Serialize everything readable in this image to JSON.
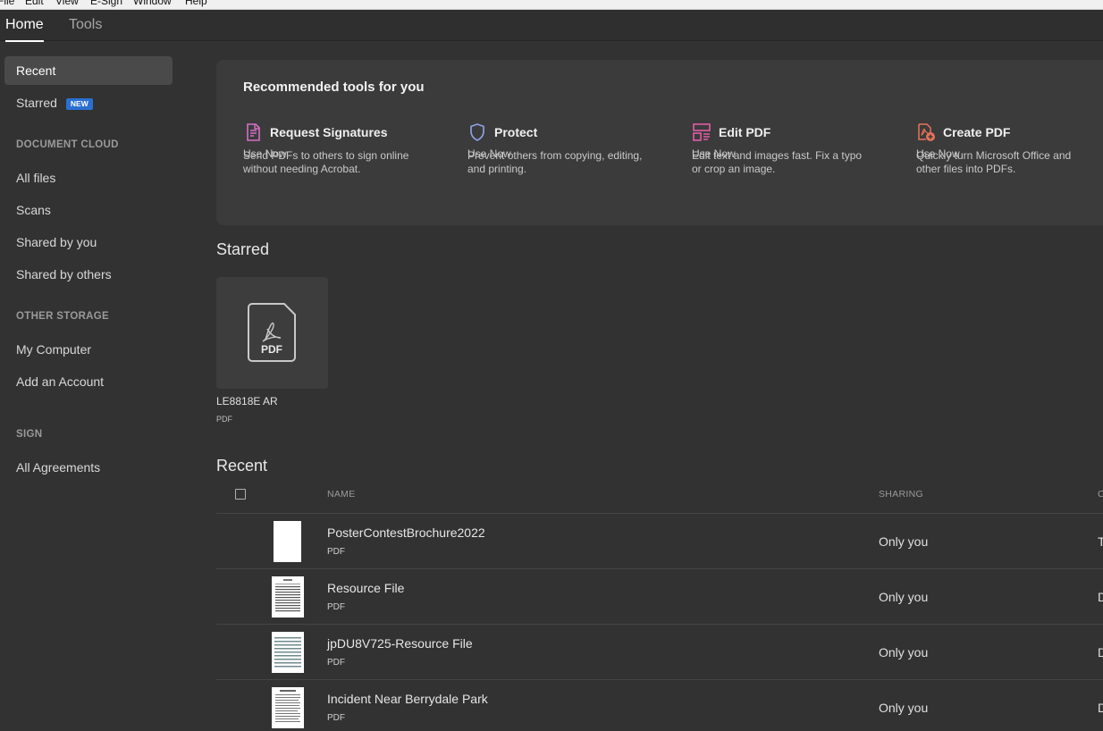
{
  "menubar": {
    "items": [
      "File",
      "Edit",
      "View",
      "E-Sign",
      "Window",
      "Help"
    ]
  },
  "tabs": [
    {
      "label": "Home",
      "active": true
    },
    {
      "label": "Tools",
      "active": false
    }
  ],
  "sidebar": {
    "recent": "Recent",
    "starred": "Starred",
    "new_badge": "NEW",
    "document_cloud_heading": "DOCUMENT CLOUD",
    "all_files": "All files",
    "scans": "Scans",
    "shared_by_you": "Shared by you",
    "shared_by_others": "Shared by others",
    "other_storage_heading": "OTHER STORAGE",
    "my_computer": "My Computer",
    "add_account": "Add an Account",
    "sign_heading": "SIGN",
    "all_agreements": "All Agreements"
  },
  "recommended": {
    "title": "Recommended tools for you",
    "tools": [
      {
        "name": "Request Signatures",
        "desc": "Send PDFs to others to sign online without needing Acrobat.",
        "action": "Use Now",
        "icon": "request-signatures-icon",
        "color": "#d46fc7"
      },
      {
        "name": "Protect",
        "desc": "Prevent others from copying, editing, and printing.",
        "action": "Use Now",
        "icon": "shield-icon",
        "color": "#8e9fe0"
      },
      {
        "name": "Edit PDF",
        "desc": "Edit text and images fast. Fix a typo or crop an image.",
        "action": "Use Now",
        "icon": "edit-pdf-icon",
        "color": "#e05ea8"
      },
      {
        "name": "Create PDF",
        "desc": "Quickly turn Microsoft Office and other files into PDFs.",
        "action": "Use Now",
        "icon": "create-pdf-icon",
        "color": "#e8735a"
      }
    ]
  },
  "starred": {
    "title": "Starred",
    "file": {
      "name": "LE8818E AR",
      "type": "PDF",
      "thumb_label": "PDF"
    }
  },
  "recent": {
    "title": "Recent",
    "columns": {
      "name": "NAME",
      "sharing": "SHARING",
      "extra": "C"
    },
    "rows": [
      {
        "name": "PosterContestBrochure2022",
        "type": "PDF",
        "sharing": "Only you",
        "extra": "T"
      },
      {
        "name": "Resource File",
        "type": "PDF",
        "sharing": "Only you",
        "extra": "D"
      },
      {
        "name": "jpDU8V725-Resource File",
        "type": "PDF",
        "sharing": "Only you",
        "extra": "D"
      },
      {
        "name": "Incident Near Berrydale Park",
        "type": "PDF",
        "sharing": "Only you",
        "extra": "D"
      }
    ]
  }
}
